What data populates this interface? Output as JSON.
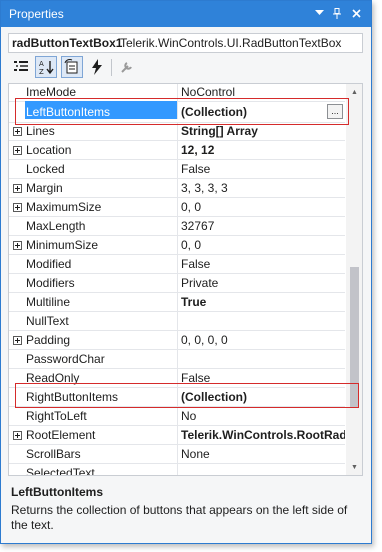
{
  "window": {
    "title": "Properties",
    "colors": {
      "titlebar": "#2f82d9",
      "selection": "#3399ff",
      "annotation": "#d52b2b"
    }
  },
  "object_selector": {
    "name": "radButtonTextBox1",
    "type": "Telerik.WinControls.UI.RadButtonTextBox"
  },
  "toolbar": {
    "icons": [
      "categorized-icon",
      "alphabetical-icon",
      "properties-icon",
      "events-icon",
      "property-pages-icon"
    ]
  },
  "properties": [
    {
      "name": "ImeMode",
      "value": "NoControl",
      "expandable": false,
      "bold": false
    },
    {
      "name": "LeftButtonItems",
      "value": "(Collection)",
      "expandable": false,
      "bold": true,
      "selected": true
    },
    {
      "name": "Lines",
      "value": "String[] Array",
      "expandable": true,
      "bold": true
    },
    {
      "name": "Location",
      "value": "12, 12",
      "expandable": true,
      "bold": true
    },
    {
      "name": "Locked",
      "value": "False",
      "expandable": false,
      "bold": false
    },
    {
      "name": "Margin",
      "value": "3, 3, 3, 3",
      "expandable": true,
      "bold": false
    },
    {
      "name": "MaximumSize",
      "value": "0, 0",
      "expandable": true,
      "bold": false
    },
    {
      "name": "MaxLength",
      "value": "32767",
      "expandable": false,
      "bold": false
    },
    {
      "name": "MinimumSize",
      "value": "0, 0",
      "expandable": true,
      "bold": false
    },
    {
      "name": "Modified",
      "value": "False",
      "expandable": false,
      "bold": false
    },
    {
      "name": "Modifiers",
      "value": "Private",
      "expandable": false,
      "bold": false
    },
    {
      "name": "Multiline",
      "value": "True",
      "expandable": false,
      "bold": true
    },
    {
      "name": "NullText",
      "value": "",
      "expandable": false,
      "bold": false
    },
    {
      "name": "Padding",
      "value": "0, 0, 0, 0",
      "expandable": true,
      "bold": false
    },
    {
      "name": "PasswordChar",
      "value": "",
      "expandable": false,
      "bold": false
    },
    {
      "name": "ReadOnly",
      "value": "False",
      "expandable": false,
      "bold": false
    },
    {
      "name": "RightButtonItems",
      "value": "(Collection)",
      "expandable": false,
      "bold": true
    },
    {
      "name": "RightToLeft",
      "value": "No",
      "expandable": false,
      "bold": false
    },
    {
      "name": "RootElement",
      "value": "Telerik.WinControls.RootRadE",
      "expandable": true,
      "bold": true
    },
    {
      "name": "ScrollBars",
      "value": "None",
      "expandable": false,
      "bold": false
    },
    {
      "name": "SelectedText",
      "value": "",
      "expandable": false,
      "bold": false
    }
  ],
  "ellipsis_label": "...",
  "description": {
    "title": "LeftButtonItems",
    "text": "Returns the collection of buttons that appears on the left side of the text."
  }
}
